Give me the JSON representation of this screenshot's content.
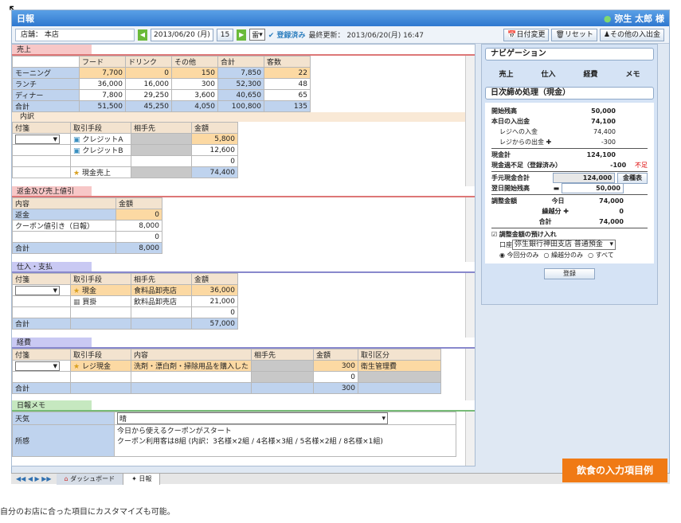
{
  "window": {
    "title": "日報",
    "user": "弥生 太郎 様"
  },
  "toolbar": {
    "store": "店舗： 本店",
    "date": "2013/06/20 (月)",
    "cal_day": "15",
    "weather": "雷",
    "saved": "登録済み",
    "last_update": "最終更新： 2013/06/20(月) 16:47",
    "btn_date_change": "日付変更",
    "btn_reset": "リセット",
    "btn_other": "その他の入出金"
  },
  "sales": {
    "title": "売上",
    "headers": [
      "フード",
      "ドリンク",
      "その他",
      "合計",
      "客数"
    ],
    "rows": [
      {
        "label": "モーニング",
        "v": [
          "7,700",
          "0",
          "150",
          "7,850",
          "22"
        ]
      },
      {
        "label": "ランチ",
        "v": [
          "36,000",
          "16,000",
          "300",
          "52,300",
          "48"
        ]
      },
      {
        "label": "ディナー",
        "v": [
          "7,800",
          "29,250",
          "3,600",
          "40,650",
          "65"
        ]
      },
      {
        "label": "合計",
        "v": [
          "51,500",
          "45,250",
          "4,050",
          "100,800",
          "135"
        ]
      }
    ]
  },
  "breakdown": {
    "title": "内訳",
    "headers": [
      "付箋",
      "取引手段",
      "相手先",
      "金額"
    ],
    "rows": [
      {
        "method": "クレジットA",
        "amount": "5,800"
      },
      {
        "method": "クレジットB",
        "amount": "12,600"
      },
      {
        "method": "",
        "amount": "0"
      },
      {
        "method": "現金売上",
        "amount": "74,400"
      }
    ]
  },
  "returns": {
    "title": "返金及び売上値引",
    "headers": [
      "内容",
      "金額"
    ],
    "rows": [
      {
        "label": "返金",
        "amount": "0"
      },
      {
        "label": "クーポン値引き（日報）",
        "amount": "8,000"
      },
      {
        "label": "",
        "amount": "0"
      },
      {
        "label": "合計",
        "amount": "8,000"
      }
    ]
  },
  "purchase": {
    "title": "仕入・支払",
    "headers": [
      "付箋",
      "取引手段",
      "相手先",
      "金額"
    ],
    "rows": [
      {
        "method": "現金",
        "partner": "食料品卸売店",
        "amount": "36,000"
      },
      {
        "method": "買掛",
        "partner": "飲料品卸売店",
        "amount": "21,000"
      },
      {
        "method": "",
        "partner": "",
        "amount": "0"
      }
    ],
    "total_label": "合計",
    "total": "57,000"
  },
  "expense": {
    "title": "経費",
    "headers": [
      "付箋",
      "取引手段",
      "内容",
      "相手先",
      "金額",
      "取引区分"
    ],
    "rows": [
      {
        "method": "レジ現金",
        "content": "洗剤・漂白剤・掃除用品を購入した",
        "amount": "300",
        "category": "衛生管理費"
      },
      {
        "method": "",
        "content": "",
        "amount": "0",
        "category": ""
      }
    ],
    "total_label": "合計",
    "total": "300"
  },
  "memo": {
    "title": "日報メモ",
    "weather_label": "天気",
    "weather_value": "晴",
    "note_label": "所感",
    "note_line1": "今日から使えるクーポンがスタート",
    "note_line2": "クーポン利用客は8組 (内訳：3名様×2組 / 4名様×3組 / 5名様×2組 / 8名様×1組)"
  },
  "nav": {
    "title": "ナビゲーション",
    "items": [
      "売上",
      "仕入",
      "経費",
      "メモ"
    ]
  },
  "closing": {
    "title": "日次締め処理（現金）",
    "opening_label": "開始残高",
    "opening": "50,000",
    "today_label": "本日の入出金",
    "today": "74,100",
    "reg_in_label": "レジへの入金",
    "reg_in": "74,400",
    "reg_out_label": "レジからの出金",
    "reg_out": "-300",
    "cash_total_label": "現金計",
    "cash_total": "124,100",
    "diff_label": "現金過不足（登録済み）",
    "diff": "-100",
    "short": "不足",
    "hand_label": "手元現金合計",
    "hand": "124,000",
    "denom_btn": "金種表",
    "next_label": "翌日開始残高",
    "next": "50,000",
    "adj_label": "調整金額",
    "adj_today_label": "今日",
    "adj_today": "74,000",
    "carry_label": "繰越分",
    "carry": "0",
    "adj_total_label": "合計",
    "adj_total": "74,000",
    "deposit_label": "調整金額の預け入れ",
    "account_label": "口座",
    "account": "弥生銀行神田支店 普通預金",
    "opt1": "今回分のみ",
    "opt2": "繰越分のみ",
    "opt3": "すべて",
    "register_btn": "登録"
  },
  "tabs": {
    "dashboard": "ダッシュボード",
    "daily": "日報"
  },
  "banner": "飲食の入力項目例",
  "caption": "自分のお店に合った項目にカスタマイズも可能。"
}
